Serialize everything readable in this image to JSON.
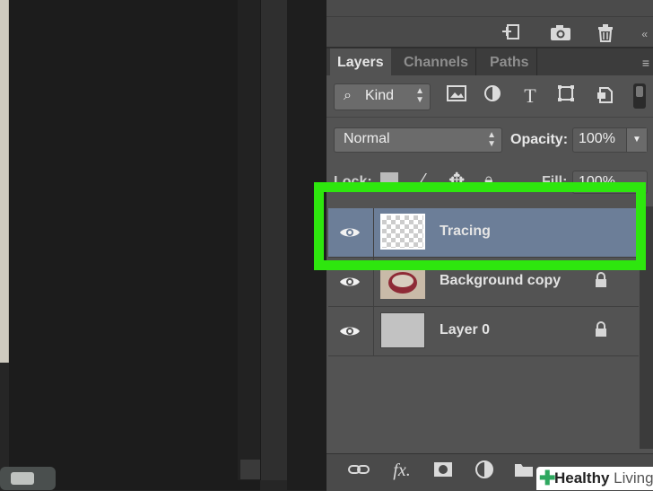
{
  "tabs": [
    "Layers",
    "Channels",
    "Paths"
  ],
  "filter": {
    "kind_label": "Kind"
  },
  "blend": {
    "mode": "Normal",
    "opacity_label": "Opacity:",
    "opacity_value": "100%"
  },
  "lock_row": {
    "lock_label": "Lock:",
    "fill_label": "Fill:",
    "fill_value": "100%"
  },
  "layers": [
    {
      "name": "Tracing",
      "selected": true,
      "locked": false,
      "thumb": "transparent"
    },
    {
      "name": "Background copy",
      "selected": false,
      "locked": true,
      "thumb": "image"
    },
    {
      "name": "Layer 0",
      "selected": false,
      "locked": true,
      "thumb": "gray"
    }
  ],
  "colors": {
    "highlight": "#2ee60e",
    "selected_row": "#6c7e98",
    "panel": "#535353"
  },
  "watermark": {
    "brand": "Healthy",
    "brand2": "Living"
  }
}
